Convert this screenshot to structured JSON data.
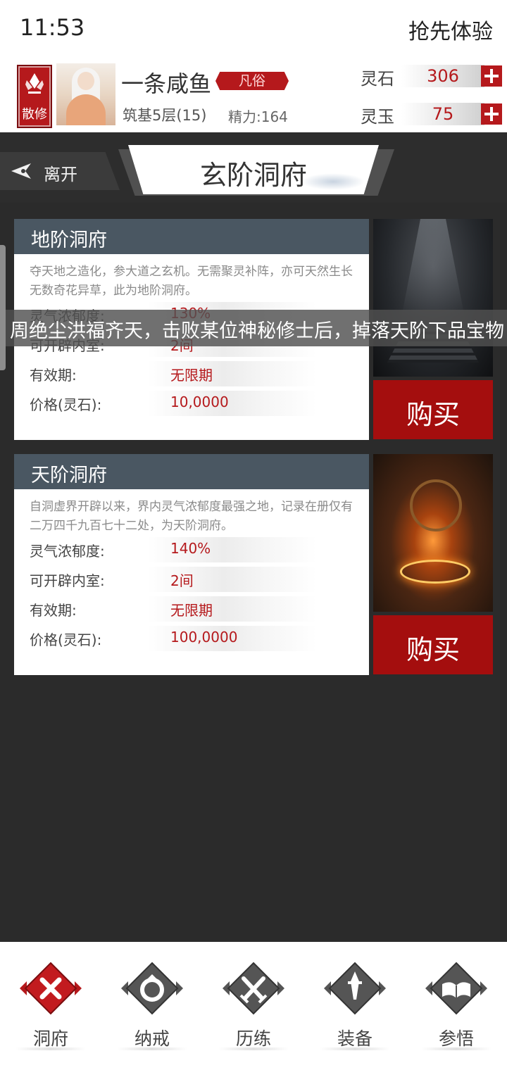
{
  "status_bar": {
    "time": "11:53",
    "trial": "抢先体验"
  },
  "profile": {
    "sect": "散修",
    "name": "一条咸鱼",
    "rank": "凡俗",
    "realm": "筑基5层(15)",
    "stamina": "精力:164",
    "resources": [
      {
        "label": "灵石",
        "value": "306"
      },
      {
        "label": "灵玉",
        "value": "75"
      }
    ]
  },
  "nav": {
    "leave": "离开",
    "title": "玄阶洞府"
  },
  "ticker": "周绝尘洪福齐天，击败某位神秘修士后，掉落天阶下品宝物",
  "cards": [
    {
      "title": "地阶洞府",
      "desc": "夺天地之造化，参大道之玄机。无需聚灵补阵，亦可天然生长无数奇花异草，此为地阶洞府。",
      "stats": [
        {
          "label": "灵气浓郁度:",
          "value": "130%"
        },
        {
          "label": "可开辟内室:",
          "value": "2间"
        },
        {
          "label": "有效期:",
          "value": "无限期"
        },
        {
          "label": "价格(灵石):",
          "value": "10,0000"
        }
      ],
      "buy": "购买"
    },
    {
      "title": "天阶洞府",
      "desc": "自洞虚界开辟以来，界内灵气浓郁度最强之地，记录在册仅有二万四千九百七十二处，为天阶洞府。",
      "stats": [
        {
          "label": "灵气浓郁度:",
          "value": "140%"
        },
        {
          "label": "可开辟内室:",
          "value": "2间"
        },
        {
          "label": "有效期:",
          "value": "无限期"
        },
        {
          "label": "价格(灵石):",
          "value": "100,0000"
        }
      ],
      "buy": "购买"
    }
  ],
  "bottom_nav": [
    {
      "label": "洞府",
      "icon": "close-x-icon",
      "active": true
    },
    {
      "label": "纳戒",
      "icon": "ring-icon",
      "active": false
    },
    {
      "label": "历练",
      "icon": "crossed-swords-icon",
      "active": false
    },
    {
      "label": "装备",
      "icon": "sword-icon",
      "active": false
    },
    {
      "label": "参悟",
      "icon": "book-icon",
      "active": false
    }
  ],
  "colors": {
    "accent": "#b5191c",
    "header": "#4a5762",
    "background": "#2b2b2b"
  }
}
